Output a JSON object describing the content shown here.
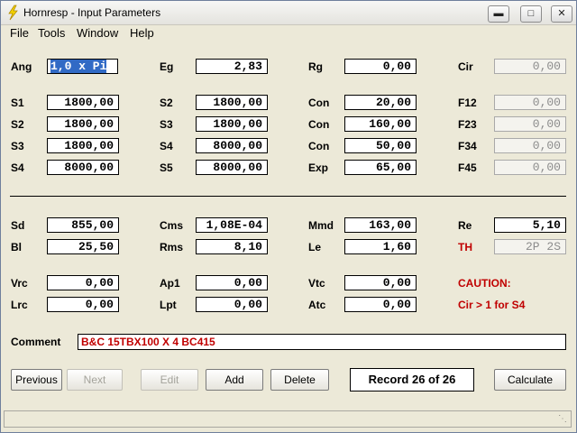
{
  "window": {
    "title": "Hornresp - Input Parameters"
  },
  "menu": [
    "File",
    "Tools",
    "Window",
    "Help"
  ],
  "params": {
    "Ang": "1,0 x Pi",
    "Eg": "2,83",
    "Rg": "0,00",
    "Cir": "0,00",
    "S1": "1800,00",
    "S2a": "1800,00",
    "Con1": "20,00",
    "F12": "0,00",
    "S2": "1800,00",
    "S3a": "1800,00",
    "Con2": "160,00",
    "F23": "0,00",
    "S3": "1800,00",
    "S4a": "8000,00",
    "Con3": "50,00",
    "F34": "0,00",
    "S4": "8000,00",
    "S5": "8000,00",
    "Exp": "65,00",
    "F45": "0,00",
    "Sd": "855,00",
    "Cms": "1,08E-04",
    "Mmd": "163,00",
    "Re": "5,10",
    "Bl": "25,50",
    "Rms": "8,10",
    "Le": "1,60",
    "TH": "2P 2S",
    "Vrc": "0,00",
    "Ap1": "0,00",
    "Vtc": "0,00",
    "Lrc": "0,00",
    "Lpt": "0,00",
    "Atc": "0,00"
  },
  "labels": {
    "Ang": "Ang",
    "Eg": "Eg",
    "Rg": "Rg",
    "Cir": "Cir",
    "S1": "S1",
    "S2": "S2",
    "S3": "S3",
    "S4": "S4",
    "S5": "S5",
    "Con": "Con",
    "Exp": "Exp",
    "F12": "F12",
    "F23": "F23",
    "F34": "F34",
    "F45": "F45",
    "Sd": "Sd",
    "Cms": "Cms",
    "Mmd": "Mmd",
    "Re": "Re",
    "Bl": "Bl",
    "Rms": "Rms",
    "Le": "Le",
    "TH": "TH",
    "Vrc": "Vrc",
    "Ap1": "Ap1",
    "Vtc": "Vtc",
    "Lrc": "Lrc",
    "Lpt": "Lpt",
    "Atc": "Atc",
    "comment": "Comment"
  },
  "caution": {
    "title": "CAUTION:",
    "message": "Cir > 1 for S4"
  },
  "comment": "B&C 15TBX100 X 4 BC415",
  "buttons": {
    "previous": "Previous",
    "next": "Next",
    "edit": "Edit",
    "add": "Add",
    "delete": "Delete",
    "calculate": "Calculate"
  },
  "record": "Record 26 of 26",
  "colors": {
    "caution": "#c00000",
    "selection": "#316ac5"
  }
}
